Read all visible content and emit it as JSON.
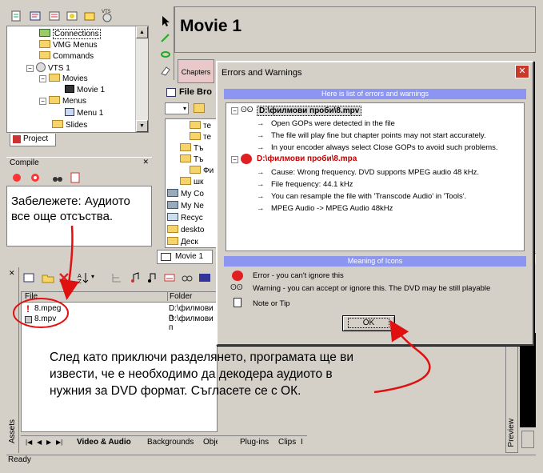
{
  "project_tree": {
    "items": [
      {
        "label": "Connections",
        "icon": "connections-icon"
      },
      {
        "label": "VMG Menus",
        "icon": "folder-icon"
      },
      {
        "label": "Commands",
        "icon": "folder-icon"
      },
      {
        "label": "VTS 1",
        "icon": "disc-icon"
      },
      {
        "label": "Movies",
        "icon": "folder-icon"
      },
      {
        "label": "Movie 1",
        "icon": "movie-icon"
      },
      {
        "label": "Menus",
        "icon": "folder-icon"
      },
      {
        "label": "Menu 1",
        "icon": "menu-icon"
      },
      {
        "label": "Slides",
        "icon": "folder-icon"
      }
    ],
    "tab": "Project"
  },
  "compile_panel": {
    "title": "Compile"
  },
  "movie_title": "Movie 1",
  "chapters_tab": "Chapters",
  "file_browser": {
    "title": "File Bro",
    "items": [
      "те",
      "те",
      "Тъ",
      "Тъ",
      "Фи",
      "шк",
      "My Co",
      "My Ne",
      "Recyc",
      "deskto",
      "Деск"
    ]
  },
  "movie_tab": "Movie 1",
  "assets": {
    "columns": [
      "File",
      "Folder"
    ],
    "rows": [
      {
        "file": "8.mpeg",
        "folder": "D:\\филмови п",
        "icon": "error-icon"
      },
      {
        "file": "8.mpv",
        "folder": "D:\\филмови п",
        "icon": "video-file-icon"
      }
    ],
    "side_label": "Assets",
    "tabs": [
      "Video & Audio",
      "Backgrounds",
      "Objects",
      "Plug-ins",
      "Clips",
      "I"
    ]
  },
  "preview_label": "Preview",
  "status_bar": "Ready",
  "dialog": {
    "title": "Errors and Warnings",
    "list_header": "Here is list of errors and warnings",
    "entries": [
      {
        "file": "D:\\филмови проби\\8.mpv",
        "type": "warning",
        "lines": [
          "Open GOPs were detected in the file",
          "The file will play fine but chapter points may not start accurately.",
          "In your encoder always select Close GOPs to avoid such problems."
        ]
      },
      {
        "file": "D:\\филмови проби\\8.mpa",
        "type": "error",
        "lines": [
          "Cause: Wrong frequency. DVD supports MPEG audio 48 kHz.",
          "File frequency: 44.1 kHz",
          "You can resample the file with 'Transcode Audio' in 'Tools'.",
          "MPEG Audio -> MPEG Audio 48kHz"
        ]
      }
    ],
    "icons_header": "Meaning of Icons",
    "legend": [
      {
        "icon": "error-icon",
        "text": "Error - you can't ignore this"
      },
      {
        "icon": "warning-icon",
        "text": "Warning - you can accept or ignore this. The DVD may be still playable"
      },
      {
        "icon": "note-icon",
        "text": "Note or Tip"
      }
    ],
    "ok_button": "OK",
    "close_glyph": "✕"
  },
  "annotations": {
    "top_left": [
      "Забележете: Аудиото",
      "все още отсъства."
    ],
    "bottom": [
      "След като приключи разделянето, програмата ще ви",
      "извести, че е необходимо да декодера аудиото в",
      "нужния за DVD формат. Съгласете се с ОК."
    ]
  },
  "colors": {
    "annotation_arrow": "#e01010",
    "info_bar": "#8c96f0",
    "error_text": "#c00000"
  }
}
